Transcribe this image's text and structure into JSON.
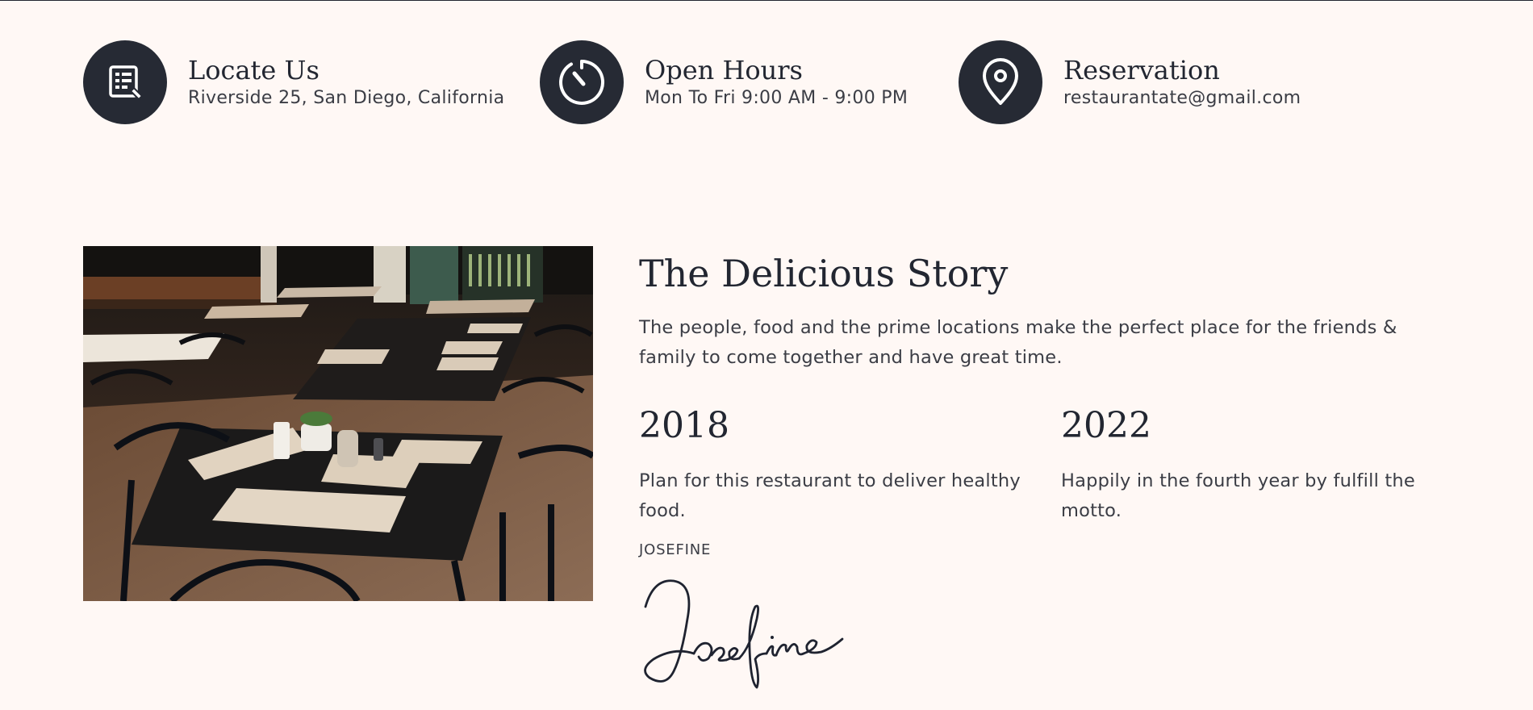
{
  "info": [
    {
      "title": "Locate Us",
      "text": "Riverside 25, San Diego, California",
      "icon": "menu-list-icon"
    },
    {
      "title": "Open Hours",
      "text": "Mon To Fri 9:00 AM - 9:00 PM",
      "icon": "clock-icon"
    },
    {
      "title": "Reservation",
      "text": "restaurantate@gmail.com",
      "icon": "location-pin-icon"
    }
  ],
  "story": {
    "title": "The Delicious Story",
    "description": "The people, food and the prime locations make the perfect place for the friends & family to come together and have great time.",
    "milestones": [
      {
        "year": "2018",
        "text": "Plan for this restaurant to deliver healthy food."
      },
      {
        "year": "2022",
        "text": "Happily in the fourth year by fulfill the motto."
      }
    ],
    "author": "JOSEFINE",
    "signature": "Josefine"
  },
  "colors": {
    "background": "#fff8f5",
    "icon_circle": "#262a34",
    "text_dark": "#222631",
    "text_body": "#3b3d45"
  }
}
